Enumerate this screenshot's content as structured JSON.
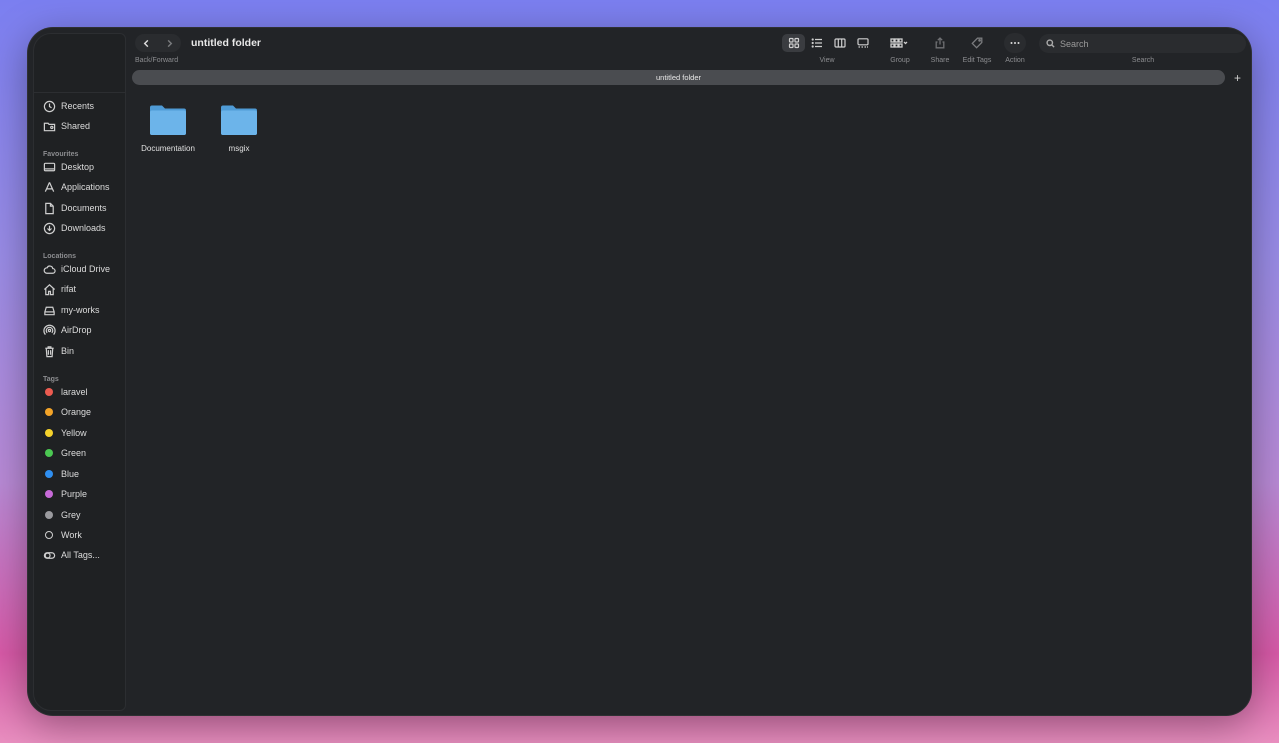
{
  "window": {
    "title": "untitled folder",
    "path": "untitled folder"
  },
  "toolbar": {
    "back_forward_label": "Back/Forward",
    "view_label": "View",
    "group_label": "Group",
    "share_label": "Share",
    "edit_tags_label": "Edit Tags",
    "action_label": "Action",
    "search_label": "Search",
    "search_placeholder": "Search",
    "active_view": "icon-view"
  },
  "sidebar": {
    "top_items": [
      {
        "label": "Recents",
        "icon": "clock-icon"
      },
      {
        "label": "Shared",
        "icon": "shared-folder-icon"
      }
    ],
    "favourites_heading": "Favourites",
    "favourites": [
      {
        "label": "Desktop",
        "icon": "desktop-icon"
      },
      {
        "label": "Applications",
        "icon": "applications-icon"
      },
      {
        "label": "Documents",
        "icon": "document-icon"
      },
      {
        "label": "Downloads",
        "icon": "download-icon"
      }
    ],
    "locations_heading": "Locations",
    "locations": [
      {
        "label": "iCloud Drive",
        "icon": "cloud-icon"
      },
      {
        "label": "rifat",
        "icon": "home-icon"
      },
      {
        "label": "my-works",
        "icon": "drive-icon"
      },
      {
        "label": "AirDrop",
        "icon": "airdrop-icon"
      },
      {
        "label": "Bin",
        "icon": "trash-icon"
      }
    ],
    "tags_heading": "Tags",
    "tags": [
      {
        "label": "laravel",
        "color": "#ec5b50"
      },
      {
        "label": "Orange",
        "color": "#f3a428"
      },
      {
        "label": "Yellow",
        "color": "#f5d22c"
      },
      {
        "label": "Green",
        "color": "#4bc852"
      },
      {
        "label": "Blue",
        "color": "#2f8ff0"
      },
      {
        "label": "Purple",
        "color": "#c76ad8"
      },
      {
        "label": "Grey",
        "color": "#9a9a9e"
      },
      {
        "label": "Work",
        "color": "none"
      }
    ],
    "all_tags_label": "All Tags..."
  },
  "files": [
    {
      "name": "Documentation",
      "icon": "folder-icon"
    },
    {
      "name": "msgix",
      "icon": "folder-icon"
    }
  ],
  "colors": {
    "folder_blue": "#6cb4ea",
    "window_bg": "#222427"
  }
}
